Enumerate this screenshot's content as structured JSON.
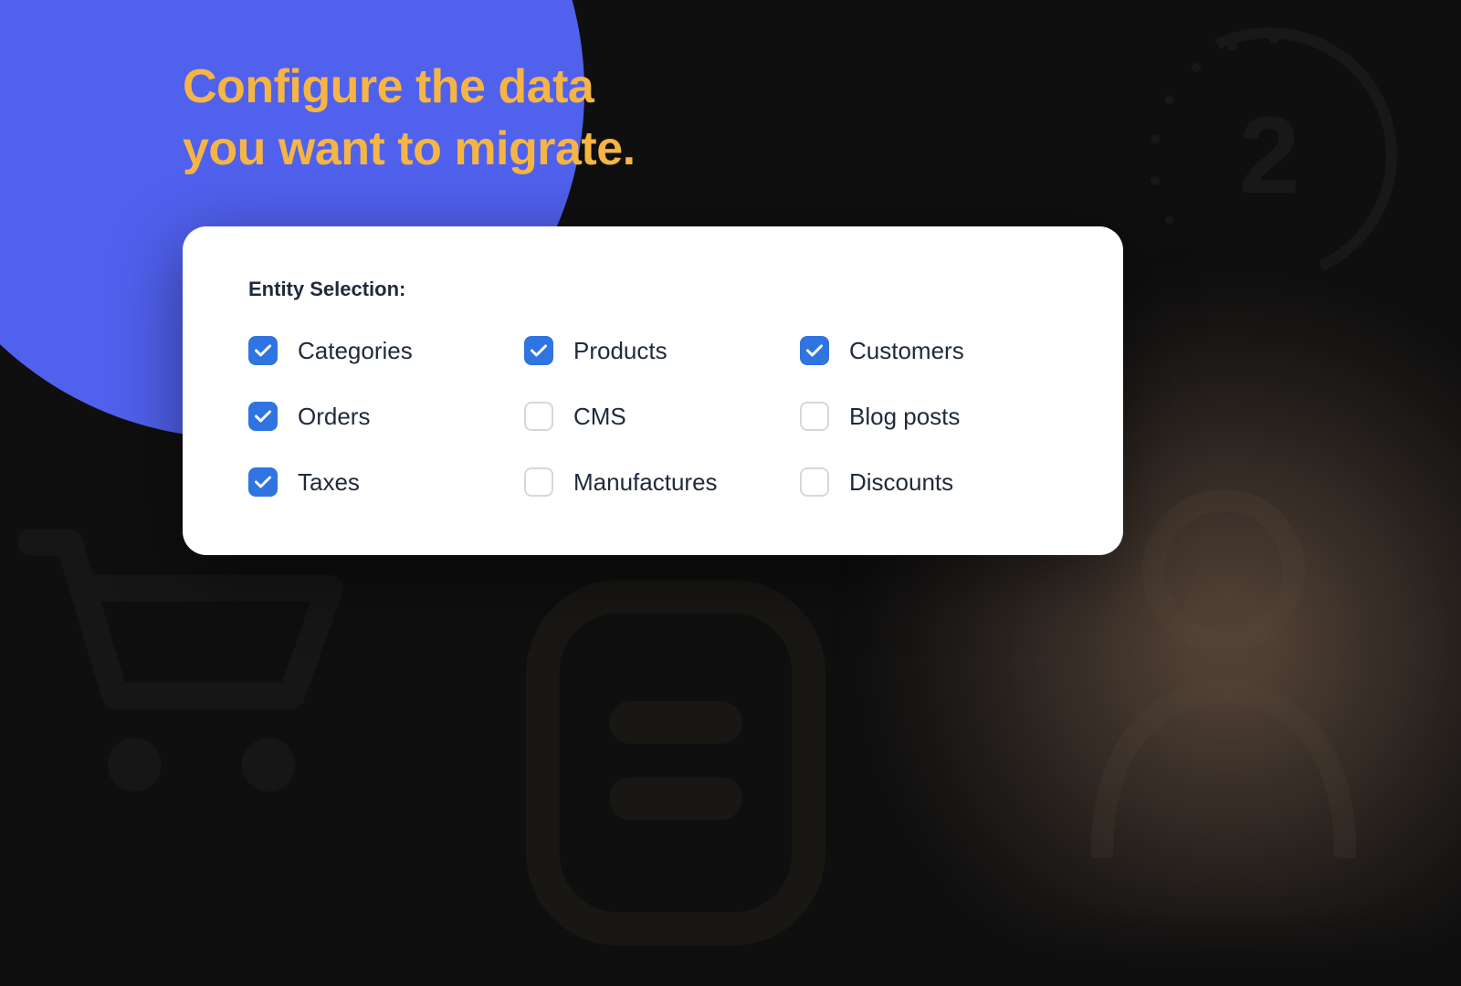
{
  "hero": {
    "title_line1": "Configure the data",
    "title_line2": "you want to migrate."
  },
  "step_number": "2",
  "card": {
    "heading": "Entity Selection:"
  },
  "options": [
    {
      "id": "categories",
      "label": "Categories",
      "checked": true
    },
    {
      "id": "products",
      "label": "Products",
      "checked": true
    },
    {
      "id": "customers",
      "label": "Customers",
      "checked": true
    },
    {
      "id": "orders",
      "label": "Orders",
      "checked": true
    },
    {
      "id": "cms",
      "label": "CMS",
      "checked": false
    },
    {
      "id": "blog-posts",
      "label": "Blog posts",
      "checked": false
    },
    {
      "id": "taxes",
      "label": "Taxes",
      "checked": true
    },
    {
      "id": "manufactures",
      "label": "Manufactures",
      "checked": false
    },
    {
      "id": "discounts",
      "label": "Discounts",
      "checked": false
    }
  ],
  "colors": {
    "accent_blue": "#5061ee",
    "checkbox_blue": "#2f74e0",
    "heading_gold": "#f5b544"
  }
}
